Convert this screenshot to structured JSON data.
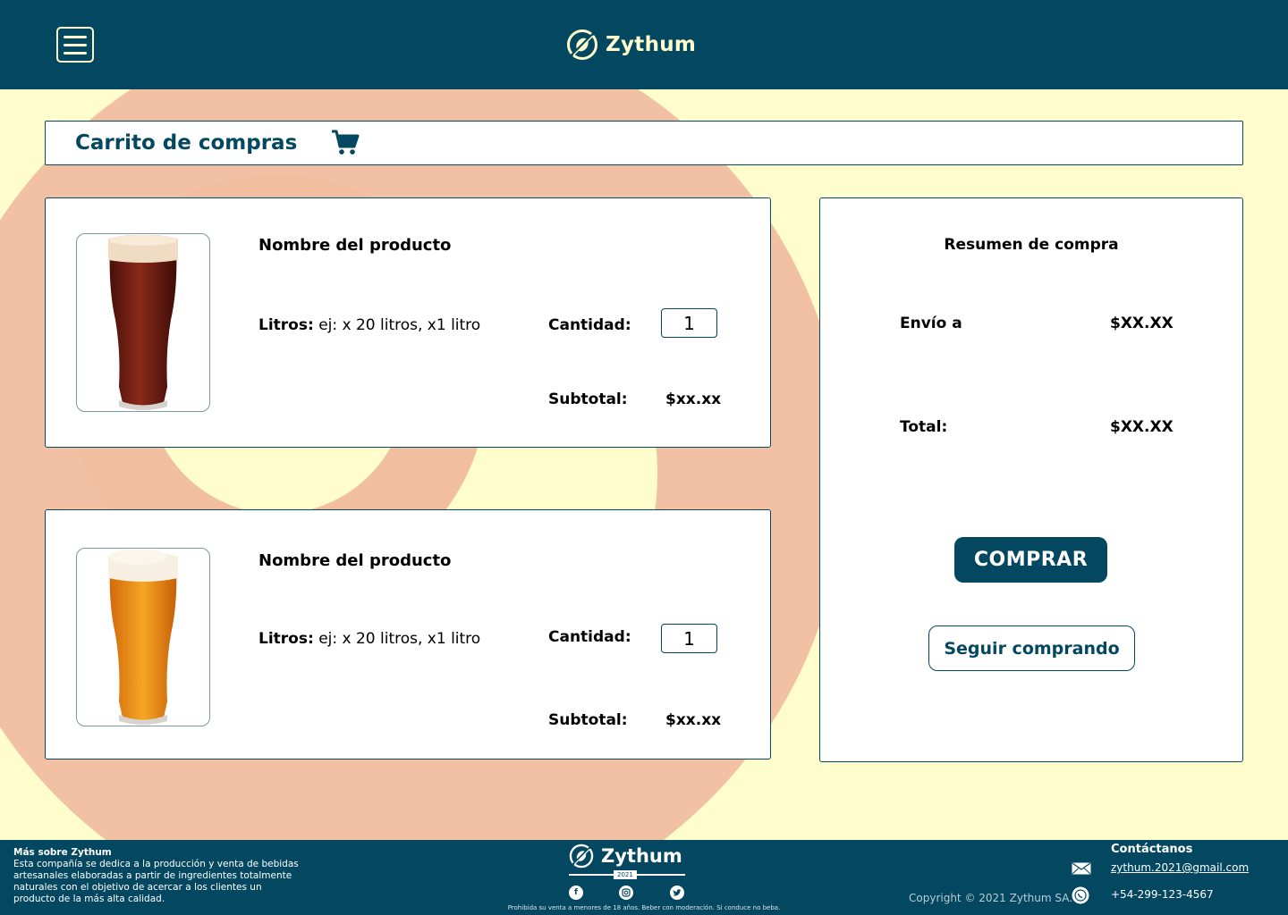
{
  "colors": {
    "primary": "#034860",
    "background": "#fefdcb",
    "decoration": "#f1bea0",
    "surface": "#ffffff"
  },
  "header": {
    "menu_icon": "hamburger-icon",
    "brand_name": "Zythum",
    "logo_icon": "zythum-logo-icon"
  },
  "page": {
    "title": "Carrito de compras",
    "title_icon": "cart-icon"
  },
  "products": [
    {
      "name": "Nombre del producto",
      "liters_label": "Litros:",
      "liters_value": "ej: x 20 litros, x1 litro",
      "quantity_label": "Cantidad:",
      "quantity": "1",
      "subtotal_label": "Subtotal:",
      "subtotal": "$xx.xx",
      "image": "dark-ale-glass-image"
    },
    {
      "name": "Nombre del producto",
      "liters_label": "Litros:",
      "liters_value": "ej: x 20 litros, x1 litro",
      "quantity_label": "Cantidad:",
      "quantity": "1",
      "subtotal_label": "Subtotal:",
      "subtotal": "$xx.xx",
      "image": "golden-ale-glass-image"
    }
  ],
  "summary": {
    "title": "Resumen de compra",
    "shipping_label": "Envío a",
    "shipping_value": "$XX.XX",
    "total_label": "Total:",
    "total_value": "$XX.XX",
    "buy_button": "COMPRAR",
    "continue_button": "Seguir comprando"
  },
  "footer": {
    "about_title": "Más sobre Zythum",
    "about_text": "Esta compañía se dedica a la producción y venta de bebidas artesanales elaboradas a partir de ingredientes totalmente naturales con el objetivo de acercar a los clientes un producto de la más alta calidad.",
    "brand_name": "Zythum",
    "year": "2021",
    "social_icons": [
      "facebook-icon",
      "instagram-icon",
      "twitter-icon"
    ],
    "legal_note": "Prohibida su venta a menores de 18 años. Beber con moderación. Si conduce no beba.",
    "copyright": "Copyright © 2021 Zythum SA.",
    "contact_title": "Contáctanos",
    "email": "zythum.2021@gmail.com",
    "phone": "+54-299-123-4567"
  }
}
